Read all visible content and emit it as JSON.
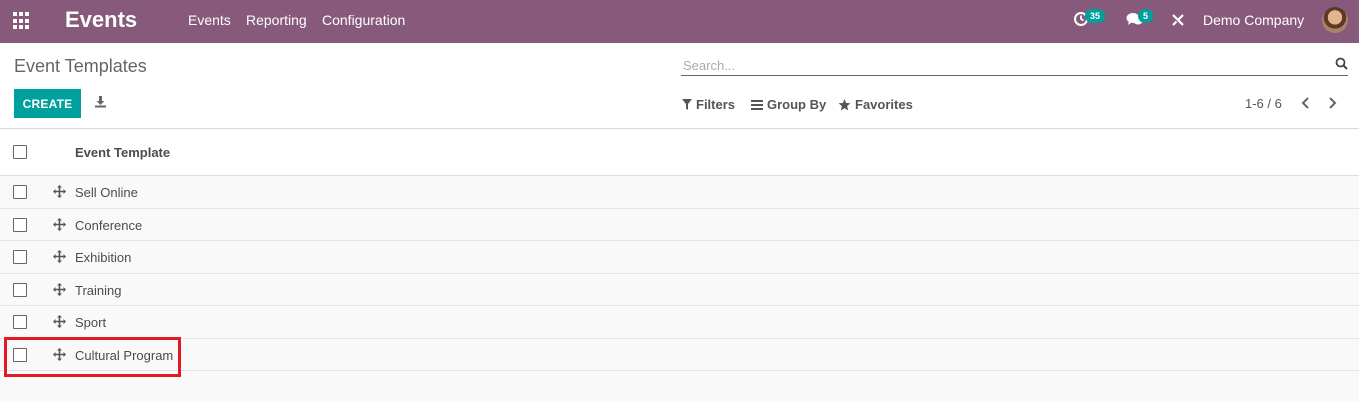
{
  "navbar": {
    "brand": "Events",
    "menu": [
      "Events",
      "Reporting",
      "Configuration"
    ],
    "activity_count": "35",
    "message_count": "5",
    "company": "Demo Company"
  },
  "control_panel": {
    "breadcrumb": "Event Templates",
    "search_placeholder": "Search...",
    "create_label": "CREATE",
    "filters_label": "Filters",
    "group_by_label": "Group By",
    "favorites_label": "Favorites",
    "pager": "1-6 / 6"
  },
  "list": {
    "column_header": "Event Template",
    "rows": [
      "Sell Online",
      "Conference",
      "Exhibition",
      "Training",
      "Sport",
      "Cultural Program"
    ]
  },
  "colors": {
    "navbar": "#875a7b",
    "primary": "#00a09d",
    "highlight": "#e01b24"
  },
  "icons": [
    "apps-icon",
    "activity-clock-icon",
    "chat-icon",
    "debug-tools-icon",
    "search-icon",
    "download-icon",
    "filter-icon",
    "group-by-icon",
    "star-icon",
    "chevron-left-icon",
    "chevron-right-icon",
    "drag-handle-icon"
  ]
}
